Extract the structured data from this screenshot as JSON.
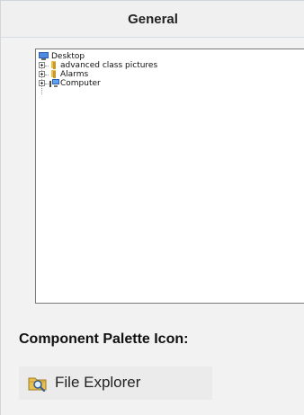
{
  "header": {
    "title": "General"
  },
  "tree": {
    "root": {
      "label": "Desktop",
      "icon": "desktop-icon"
    },
    "children": [
      {
        "label": "advanced class pictures",
        "icon": "folder-icon"
      },
      {
        "label": "Alarms",
        "icon": "folder-icon"
      },
      {
        "label": "Computer",
        "icon": "computer-icon"
      }
    ]
  },
  "section": {
    "title": "Component Palette Icon:"
  },
  "palette": {
    "label": "File Explorer",
    "icon": "folder-search-icon"
  },
  "colors": {
    "header_bg": "#f0f0f0",
    "content_bg": "#f2f2f2",
    "folder": "#e8c050",
    "desktop": "#2b5fb5"
  }
}
